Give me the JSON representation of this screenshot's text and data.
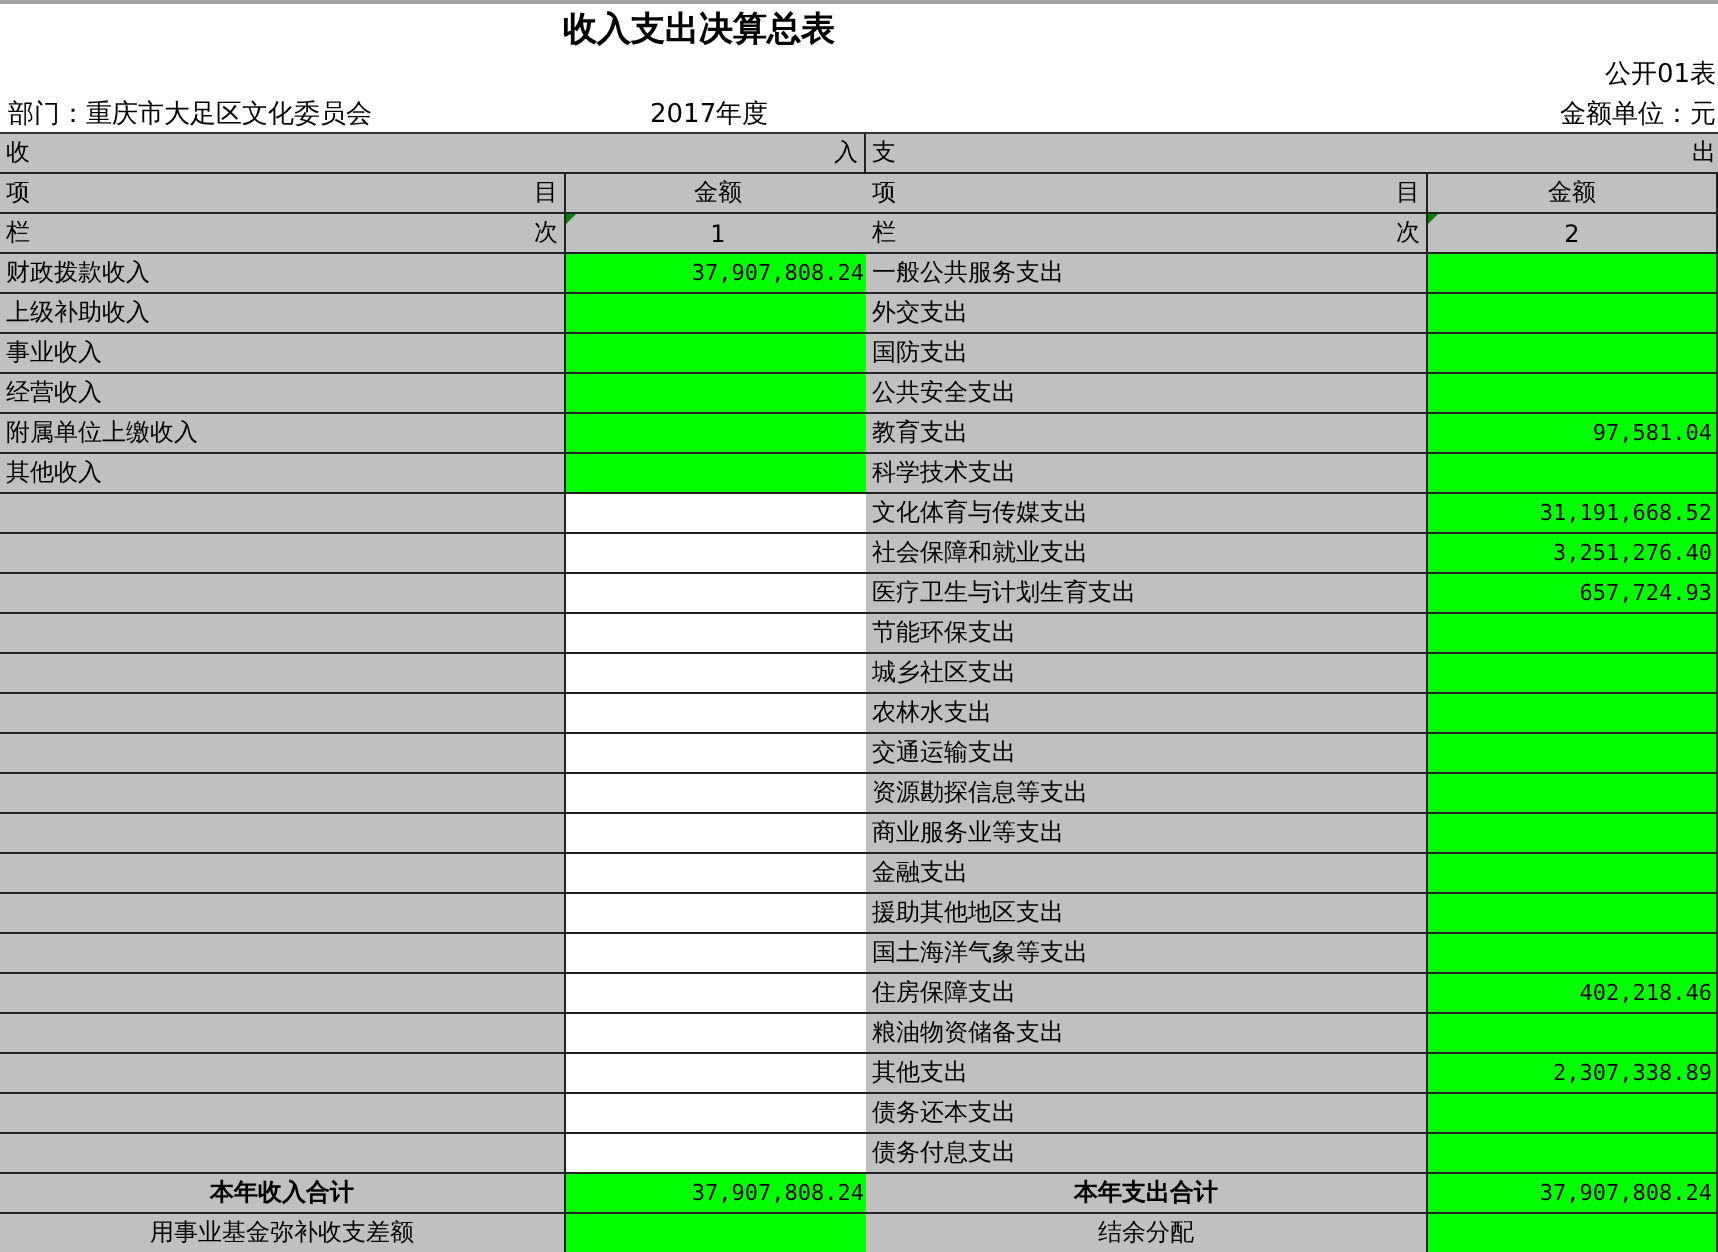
{
  "title": "收入支出决算总表",
  "form_no": "公开01表",
  "department": "部门：重庆市大足区文化委员会",
  "year": "2017年度",
  "unit": "金额单位：元",
  "sections": [
    {
      "heading_left": "收",
      "heading_right": "入",
      "item_left": "项",
      "item_right": "目",
      "amount_heading": "金额",
      "index_left": "栏",
      "index_right": "次",
      "index": "1"
    },
    {
      "heading_left": "支",
      "heading_right": "出",
      "item_left": "项",
      "item_right": "目",
      "amount_heading": "金额",
      "index_left": "栏",
      "index_right": "次",
      "index": "2"
    }
  ],
  "income": [
    {
      "name": "财政拨款收入",
      "amount": "37,907,808.24",
      "highlight": true
    },
    {
      "name": "上级补助收入",
      "highlight": true
    },
    {
      "name": "事业收入",
      "highlight": true
    },
    {
      "name": "经营收入",
      "highlight": true
    },
    {
      "name": "附属单位上缴收入",
      "highlight": true
    },
    {
      "name": "其他收入",
      "highlight": true
    }
  ],
  "expense": [
    {
      "name": "一般公共服务支出",
      "highlight": true
    },
    {
      "name": "外交支出",
      "highlight": true
    },
    {
      "name": "国防支出",
      "highlight": true
    },
    {
      "name": "公共安全支出",
      "highlight": true
    },
    {
      "name": "教育支出",
      "amount": "97,581.04",
      "highlight": true
    },
    {
      "name": "科学技术支出",
      "highlight": true
    },
    {
      "name": "文化体育与传媒支出",
      "amount": "31,191,668.52",
      "highlight": true
    },
    {
      "name": "社会保障和就业支出",
      "amount": "3,251,276.40",
      "highlight": true
    },
    {
      "name": "医疗卫生与计划生育支出",
      "amount": "657,724.93",
      "highlight": true
    },
    {
      "name": "节能环保支出",
      "highlight": true
    },
    {
      "name": "城乡社区支出",
      "highlight": true
    },
    {
      "name": "农林水支出",
      "highlight": true
    },
    {
      "name": "交通运输支出",
      "highlight": true
    },
    {
      "name": "资源勘探信息等支出",
      "highlight": true
    },
    {
      "name": "商业服务业等支出",
      "highlight": true
    },
    {
      "name": "金融支出",
      "highlight": true
    },
    {
      "name": "援助其他地区支出",
      "highlight": true
    },
    {
      "name": "国土海洋气象等支出",
      "highlight": true
    },
    {
      "name": "住房保障支出",
      "amount": "402,218.46",
      "highlight": true
    },
    {
      "name": "粮油物资储备支出",
      "highlight": true
    },
    {
      "name": "其他支出",
      "amount": "2,307,338.89",
      "highlight": true
    },
    {
      "name": "债务还本支出",
      "highlight": true
    },
    {
      "name": "债务付息支出",
      "highlight": true
    }
  ],
  "totals": [
    {
      "name": "本年收入合计",
      "amount": "37,907,808.24",
      "highlight": true
    },
    {
      "name": "本年支出合计",
      "amount": "37,907,808.24",
      "highlight": true
    }
  ],
  "balance": [
    {
      "name": "用事业基金弥补收支差额",
      "highlight": true
    },
    {
      "name": "结余分配",
      "highlight": true
    }
  ]
}
